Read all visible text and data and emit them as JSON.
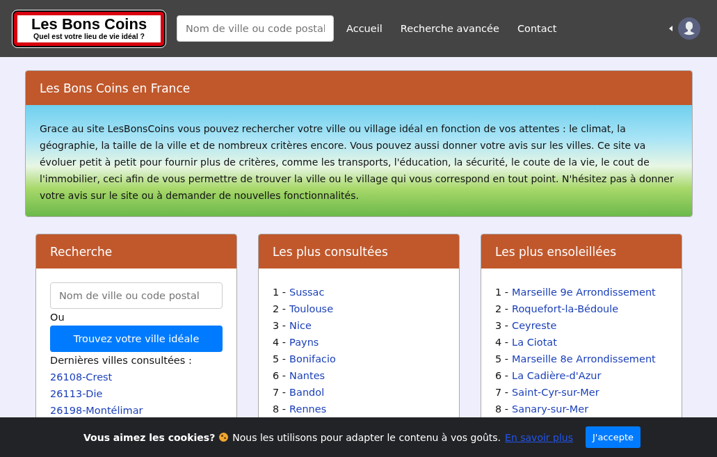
{
  "navbar": {
    "logo": {
      "title": "Les Bons Coins",
      "tagline": "Quel est votre lieu de vie idéal ?"
    },
    "search": {
      "placeholder": "Nom de ville ou code postal"
    },
    "links": [
      "Accueil",
      "Recherche avancée",
      "Contact"
    ]
  },
  "intro": {
    "title": "Les Bons Coins en France",
    "text": "Grace au site LesBonsCoins vous pouvez rechercher votre ville ou village idéal en fonction de vos attentes : le climat, la géographie, la taille de la ville et de nombreux critères encore. Vous pouvez aussi donner votre avis sur les villes. Ce site va évoluer petit à petit pour fournir plus de critères, comme les transports, l'éducation, la sécurité, le coute de la vie, le cout de l'immobilier, ceci afin de vous permettre de trouver la ville ou le village qui vous correspond en tout point. N'hésitez pas à donner votre avis sur le site ou à demander de nouvelles fonctionnalités."
  },
  "cards": [
    {
      "kind": "search",
      "title": "Recherche",
      "placeholder": "Nom de ville ou code postal",
      "or": "Ou",
      "button": "Trouvez votre ville idéale",
      "recent_label": "Dernières villes consultées :",
      "recent": [
        "26108-Crest",
        "26113-Die",
        "26198-Montélimar"
      ]
    },
    {
      "kind": "ranking",
      "title": "Les plus consultées",
      "items": [
        {
          "rank": "1 -",
          "name": "Sussac"
        },
        {
          "rank": "2 -",
          "name": "Toulouse"
        },
        {
          "rank": "3 -",
          "name": "Nice"
        },
        {
          "rank": "4 -",
          "name": "Payns"
        },
        {
          "rank": "5 -",
          "name": "Bonifacio"
        },
        {
          "rank": "6 -",
          "name": "Nantes"
        },
        {
          "rank": "7 -",
          "name": "Bandol"
        },
        {
          "rank": "8 -",
          "name": "Rennes"
        }
      ]
    },
    {
      "kind": "ranking",
      "title": "Les plus ensoleillées",
      "items": [
        {
          "rank": "1 -",
          "name": "Marseille 9e Arrondissement"
        },
        {
          "rank": "2 -",
          "name": "Roquefort-la-Bédoule"
        },
        {
          "rank": "3 -",
          "name": "Ceyreste"
        },
        {
          "rank": "4 -",
          "name": "La Ciotat"
        },
        {
          "rank": "5 -",
          "name": "Marseille 8e Arrondissement"
        },
        {
          "rank": "6 -",
          "name": "La Cadière-d'Azur"
        },
        {
          "rank": "7 -",
          "name": "Saint-Cyr-sur-Mer"
        },
        {
          "rank": "8 -",
          "name": "Sanary-sur-Mer"
        }
      ]
    }
  ],
  "cookie_bar": {
    "title": "Vous aimez les cookies?",
    "text": "Nous les utilisons pour adapter le contenu à vos goûts.",
    "link": "En savoir plus",
    "button": "J'accepte"
  }
}
